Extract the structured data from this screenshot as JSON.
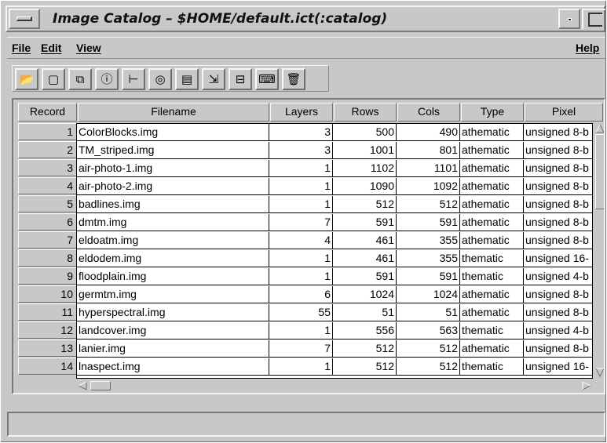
{
  "window": {
    "title": "Image Catalog – $HOME/default.ict(:catalog)"
  },
  "menubar": {
    "file": "File",
    "edit": "Edit",
    "view": "View",
    "help": "Help"
  },
  "toolbar": {
    "buttons": [
      {
        "icon": "open-folder-icon",
        "glyph": "📂"
      },
      {
        "icon": "viewer-icon",
        "glyph": "▢"
      },
      {
        "icon": "copy-icon",
        "glyph": "⧉"
      },
      {
        "icon": "info-icon",
        "glyph": "ⓘ"
      },
      {
        "icon": "layer-tree-icon",
        "glyph": "⊢"
      },
      {
        "icon": "color-wheel-icon",
        "glyph": "◎"
      },
      {
        "icon": "report-icon",
        "glyph": "▤"
      },
      {
        "icon": "save-to-icon",
        "glyph": "⇲"
      },
      {
        "icon": "save-icon",
        "glyph": "⊟"
      },
      {
        "icon": "keyboard-icon",
        "glyph": "⌨"
      },
      {
        "icon": "trash-icon",
        "glyph": "🗑"
      }
    ]
  },
  "table": {
    "columns": [
      "Record",
      "Filename",
      "Layers",
      "Rows",
      "Cols",
      "Type",
      "Pixel"
    ],
    "rows": [
      {
        "record": "1",
        "filename": "ColorBlocks.img",
        "layers": "3",
        "rows": "500",
        "cols": "490",
        "type": "athematic",
        "pixel": "unsigned 8-b"
      },
      {
        "record": "2",
        "filename": "TM_striped.img",
        "layers": "3",
        "rows": "1001",
        "cols": "801",
        "type": "athematic",
        "pixel": "unsigned 8-b"
      },
      {
        "record": "3",
        "filename": "air-photo-1.img",
        "layers": "1",
        "rows": "1102",
        "cols": "1101",
        "type": "athematic",
        "pixel": "unsigned 8-b"
      },
      {
        "record": "4",
        "filename": "air-photo-2.img",
        "layers": "1",
        "rows": "1090",
        "cols": "1092",
        "type": "athematic",
        "pixel": "unsigned 8-b"
      },
      {
        "record": "5",
        "filename": "badlines.img",
        "layers": "1",
        "rows": "512",
        "cols": "512",
        "type": "athematic",
        "pixel": "unsigned 8-b"
      },
      {
        "record": "6",
        "filename": "dmtm.img",
        "layers": "7",
        "rows": "591",
        "cols": "591",
        "type": "athematic",
        "pixel": "unsigned 8-b"
      },
      {
        "record": "7",
        "filename": "eldoatm.img",
        "layers": "4",
        "rows": "461",
        "cols": "355",
        "type": "athematic",
        "pixel": "unsigned 8-b"
      },
      {
        "record": "8",
        "filename": "eldodem.img",
        "layers": "1",
        "rows": "461",
        "cols": "355",
        "type": "thematic",
        "pixel": "unsigned 16-"
      },
      {
        "record": "9",
        "filename": "floodplain.img",
        "layers": "1",
        "rows": "591",
        "cols": "591",
        "type": "thematic",
        "pixel": "unsigned 4-b"
      },
      {
        "record": "10",
        "filename": "germtm.img",
        "layers": "6",
        "rows": "1024",
        "cols": "1024",
        "type": "athematic",
        "pixel": "unsigned 8-b"
      },
      {
        "record": "11",
        "filename": "hyperspectral.img",
        "layers": "55",
        "rows": "51",
        "cols": "51",
        "type": "athematic",
        "pixel": "unsigned 8-b"
      },
      {
        "record": "12",
        "filename": "landcover.img",
        "layers": "1",
        "rows": "556",
        "cols": "563",
        "type": "thematic",
        "pixel": "unsigned 4-b"
      },
      {
        "record": "13",
        "filename": "lanier.img",
        "layers": "7",
        "rows": "512",
        "cols": "512",
        "type": "athematic",
        "pixel": "unsigned 8-b"
      },
      {
        "record": "14",
        "filename": "lnaspect.img",
        "layers": "1",
        "rows": "512",
        "cols": "512",
        "type": "thematic",
        "pixel": "unsigned 16-"
      }
    ]
  },
  "status": {
    "text": ""
  }
}
